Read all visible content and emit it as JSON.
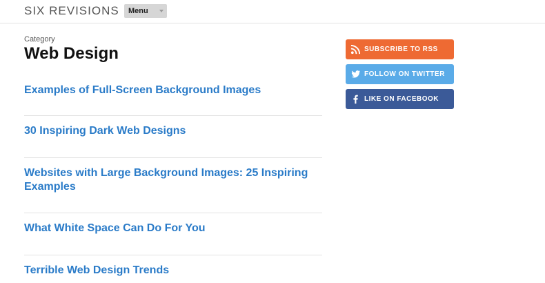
{
  "header": {
    "site_title": "SIX REVISIONS",
    "menu_label": "Menu"
  },
  "main": {
    "category_label": "Category",
    "page_title": "Web Design",
    "articles": [
      {
        "title": "Examples of Full-Screen Background Images"
      },
      {
        "title": "30 Inspiring Dark Web Designs"
      },
      {
        "title": "Websites with Large Background Images: 25 Inspiring Examples"
      },
      {
        "title": "What White Space Can Do For You"
      },
      {
        "title": "Terrible Web Design Trends"
      }
    ]
  },
  "sidebar": {
    "buttons": [
      {
        "label": "SUBSCRIBE TO RSS",
        "icon": "rss-icon",
        "color": "#ee6a33"
      },
      {
        "label": "FOLLOW ON TWITTER",
        "icon": "twitter-icon",
        "color": "#5aabe8"
      },
      {
        "label": "LIKE ON FACEBOOK",
        "icon": "facebook-icon",
        "color": "#3b5a98"
      }
    ]
  },
  "colors": {
    "link": "#2a7bc8",
    "title": "#111111",
    "divider": "#e2e2e2"
  }
}
